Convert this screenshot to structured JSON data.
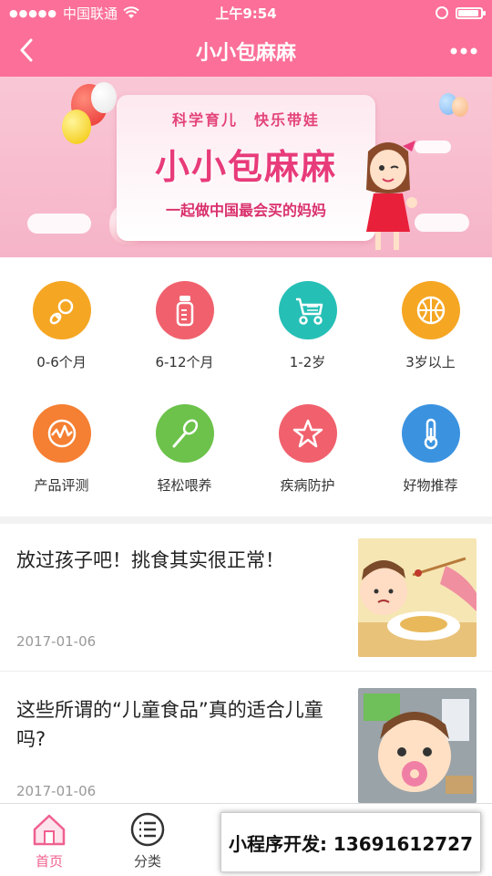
{
  "status_bar": {
    "carrier": "中国联通",
    "time": "上午9:54"
  },
  "nav": {
    "title": "小小包麻麻"
  },
  "banner": {
    "slogan": "科学育儿　快乐带娃",
    "brand": "小小包麻麻",
    "subtitle": "一起做中国最会买的妈妈"
  },
  "categories": [
    {
      "label": "0-6个月",
      "icon": "pacifier-icon",
      "color": "#f5a623"
    },
    {
      "label": "6-12个月",
      "icon": "baby-bottle-icon",
      "color": "#f0616d"
    },
    {
      "label": "1-2岁",
      "icon": "stroller-icon",
      "color": "#26bfb5"
    },
    {
      "label": "3岁以上",
      "icon": "ball-icon",
      "color": "#f5a623"
    },
    {
      "label": "产品评测",
      "icon": "chart-icon",
      "color": "#f57f32"
    },
    {
      "label": "轻松喂养",
      "icon": "spoon-icon",
      "color": "#6cc24a"
    },
    {
      "label": "疾病防护",
      "icon": "star-icon",
      "color": "#f0616d"
    },
    {
      "label": "好物推荐",
      "icon": "thermometer-icon",
      "color": "#3b93e0"
    }
  ],
  "articles": [
    {
      "title": "放过孩子吧！挑食其实很正常！",
      "date": "2017-01-06"
    },
    {
      "title": "这些所谓的“儿童食品”真的适合儿童吗?",
      "date": "2017-01-06"
    }
  ],
  "tabs": [
    {
      "label": "首页",
      "icon": "home-icon"
    },
    {
      "label": "分类",
      "icon": "list-icon"
    }
  ],
  "promo": {
    "text": "小程序开发: 13691612727"
  },
  "colors": {
    "brand_pink": "#fb6f98",
    "active_tab": "#f0608f"
  }
}
